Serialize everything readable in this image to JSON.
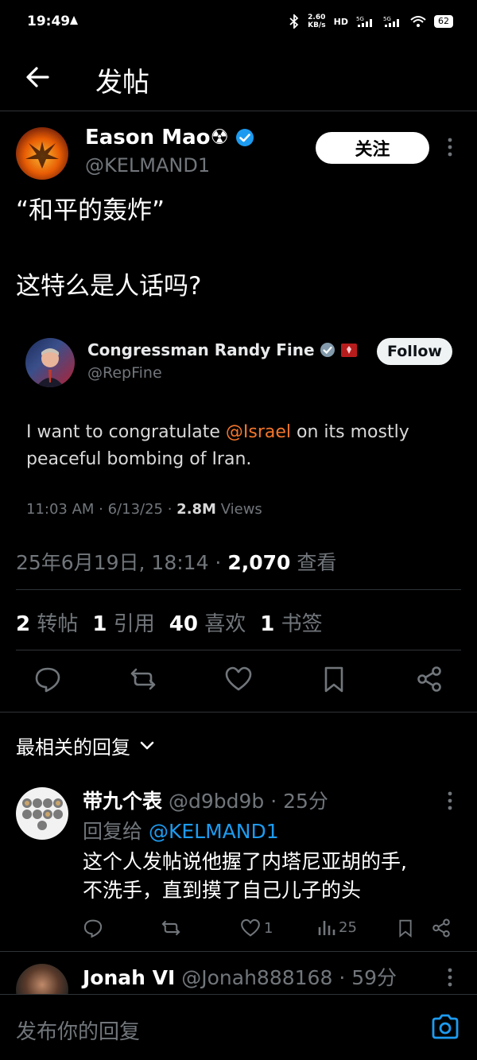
{
  "status_bar": {
    "time": "19:49",
    "net_speed_top": "2.60",
    "net_speed_unit": "KB/s",
    "battery": "62"
  },
  "header": {
    "title": "发帖"
  },
  "post": {
    "author_name": "Eason Mao☢",
    "author_handle": "@KELMAND1",
    "follow_label": "关注",
    "text_line1": "“和平的轰炸”",
    "text_line2": "这特么是人话吗?",
    "timestamp": "25年6月19日, 18:14",
    "views_count": "2,070",
    "views_label": "查看",
    "stats": {
      "reposts_count": "2",
      "reposts_label": "转帖",
      "quotes_count": "1",
      "quotes_label": "引用",
      "likes_count": "40",
      "likes_label": "喜欢",
      "bookmarks_count": "1",
      "bookmarks_label": "书签"
    }
  },
  "quoted": {
    "author_name": "Congressman Randy Fine",
    "author_handle": "@RepFine",
    "follow_label": "Follow",
    "text_pre": "I want to congratulate ",
    "mention": "@Israel",
    "text_post": " on its mostly",
    "text_line2": "peaceful bombing of Iran.",
    "meta_time": "11:03 AM · 6/13/25 · ",
    "meta_views": "2.8M",
    "meta_views_label": " Views"
  },
  "replies_header": {
    "label": "最相关的回复"
  },
  "replies": [
    {
      "name": "带九个表",
      "handle": "@d9bd9b",
      "age": "· 25分",
      "reply_to_label": "回复给",
      "reply_to_handle": "@KELMAND1",
      "line1": "这个人发帖说他握了内塔尼亚胡的手,",
      "line2": "不洗手，直到摸了自己儿子的头",
      "likes": "1",
      "views": "25"
    },
    {
      "name": "Jonah VI",
      "handle": "@Jonah888168",
      "age": "· 59分"
    }
  ],
  "reply_bar": {
    "placeholder": "发布你的回复"
  },
  "colors": {
    "accent": "#1d9bf0",
    "mention_quoted": "#f4762b",
    "background": "#000000"
  }
}
